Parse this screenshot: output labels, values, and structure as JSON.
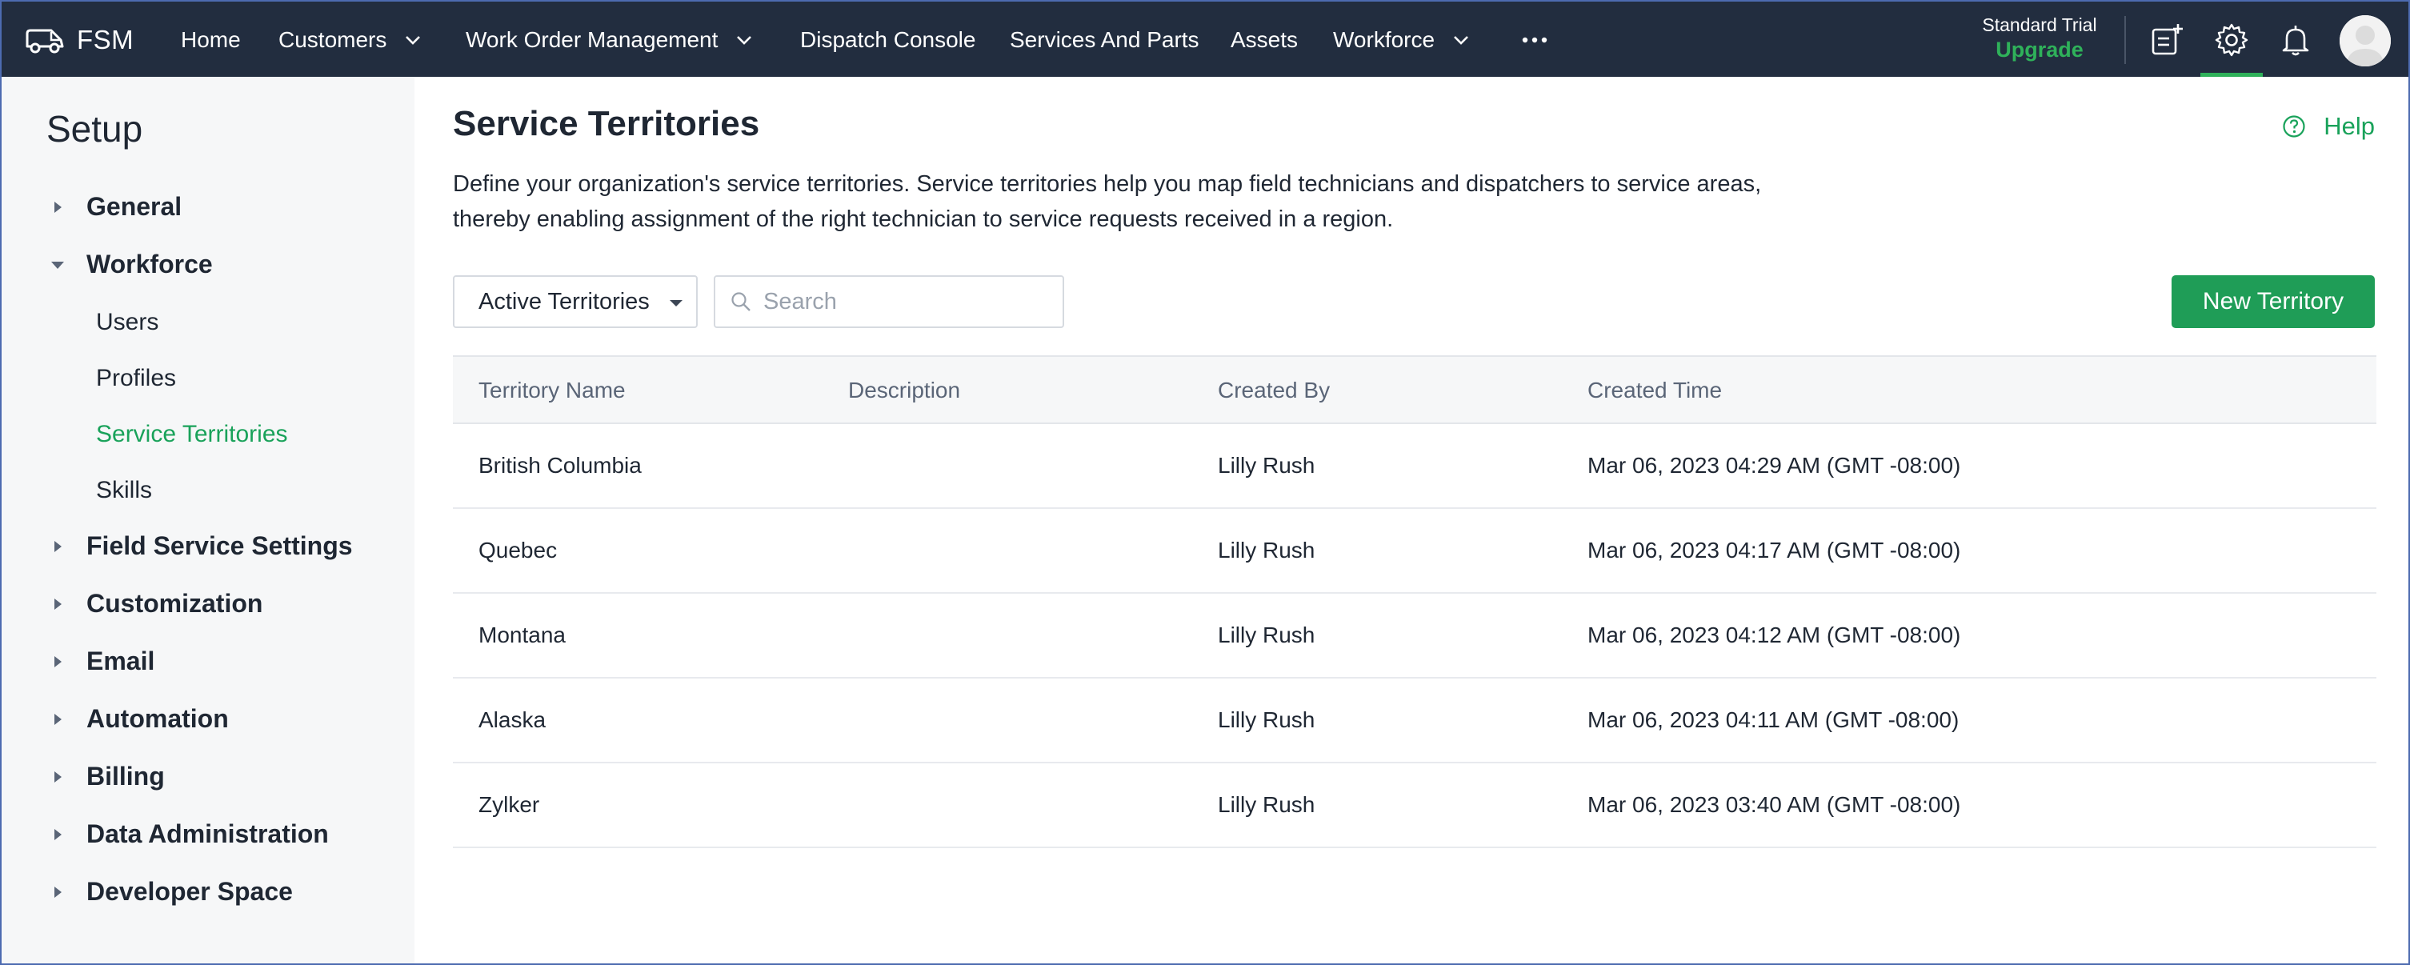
{
  "app": {
    "brand": "FSM"
  },
  "nav": {
    "items": [
      {
        "label": "Home"
      },
      {
        "label": "Customers"
      },
      {
        "label": "Work Order Management"
      },
      {
        "label": "Dispatch Console"
      },
      {
        "label": "Services And Parts"
      },
      {
        "label": "Assets"
      },
      {
        "label": "Workforce"
      }
    ],
    "trial_label": "Standard Trial",
    "upgrade_label": "Upgrade"
  },
  "sidebar": {
    "title": "Setup",
    "groups": [
      {
        "label": "General",
        "expanded": false
      },
      {
        "label": "Workforce",
        "expanded": true,
        "items": [
          {
            "label": "Users"
          },
          {
            "label": "Profiles"
          },
          {
            "label": "Service Territories",
            "active": true
          },
          {
            "label": "Skills"
          }
        ]
      },
      {
        "label": "Field Service Settings",
        "expanded": false
      },
      {
        "label": "Customization",
        "expanded": false
      },
      {
        "label": "Email",
        "expanded": false
      },
      {
        "label": "Automation",
        "expanded": false
      },
      {
        "label": "Billing",
        "expanded": false
      },
      {
        "label": "Data Administration",
        "expanded": false
      },
      {
        "label": "Developer Space",
        "expanded": false
      }
    ]
  },
  "main": {
    "title": "Service Territories",
    "help_label": "Help",
    "description_line1": "Define your organization's service territories. Service territories help you map field technicians and dispatchers to service areas,",
    "description_line2": "thereby enabling assignment of the right technician to service requests received in a region.",
    "filter_value": "Active Territories",
    "search_placeholder": "Search",
    "search_value": "",
    "new_button_label": "New Territory"
  },
  "table": {
    "columns": [
      "Territory Name",
      "Description",
      "Created By",
      "Created Time"
    ],
    "rows": [
      {
        "name": "British Columbia",
        "description": "",
        "created_by": "Lilly Rush",
        "created_time": "Mar 06, 2023 04:29 AM (GMT -08:00)"
      },
      {
        "name": "Quebec",
        "description": "",
        "created_by": "Lilly Rush",
        "created_time": "Mar 06, 2023 04:17 AM (GMT -08:00)"
      },
      {
        "name": "Montana",
        "description": "",
        "created_by": "Lilly Rush",
        "created_time": "Mar 06, 2023 04:12 AM (GMT -08:00)"
      },
      {
        "name": "Alaska",
        "description": "",
        "created_by": "Lilly Rush",
        "created_time": "Mar 06, 2023 04:11 AM (GMT -08:00)"
      },
      {
        "name": "Zylker",
        "description": "",
        "created_by": "Lilly Rush",
        "created_time": "Mar 06, 2023 03:40 AM (GMT -08:00)"
      }
    ]
  },
  "icons": {
    "brand": "van-icon",
    "more": "more-horizontal-icon",
    "add_note": "add-note-icon",
    "settings": "gear-icon",
    "notifications": "bell-icon",
    "help": "help-circle-icon",
    "search": "search-icon"
  },
  "colors": {
    "topbar_bg": "#222d3f",
    "accent_green": "#1f9d57",
    "upgrade_green": "#2fb15a",
    "active_link": "#19a25a",
    "sidebar_bg": "#f6f7f8"
  }
}
